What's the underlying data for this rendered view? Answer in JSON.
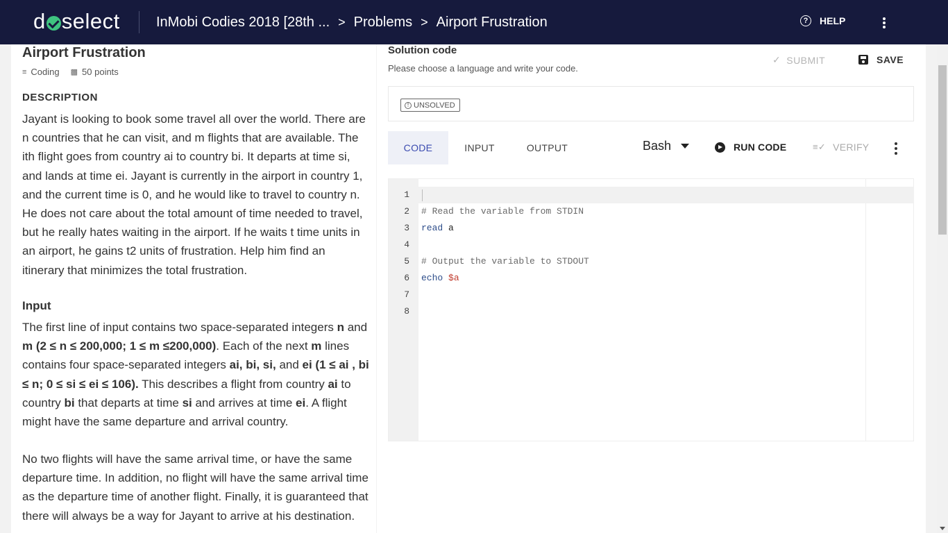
{
  "header": {
    "logo_pre": "d",
    "logo_post": "select",
    "breadcrumbs": [
      "InMobi Codies 2018 [28th ...",
      "Problems",
      "Airport Frustration"
    ],
    "separator": ">",
    "help_label": "HELP",
    "help_icon": "?"
  },
  "problem": {
    "title": "Airport Frustration",
    "type_label": "Coding",
    "points_label": "50 points",
    "description_heading": "DESCRIPTION",
    "description": "Jayant is looking to book some travel all over the world. There are n countries that he can visit, and m flights that are available. The ith flight goes from country ai to country bi. It departs at time si, and lands at time ei. Jayant is currently in the airport in country 1, and the current time is 0, and he would like to travel to country n. He does not care about the total amount of time needed to travel, but he really hates waiting in the airport. If he waits t time units in an airport, he gains t2 units of frustration. Help him find an itinerary that minimizes the total frustration.",
    "input_heading": "Input",
    "input_parts": [
      "The first line of input contains two space-separated integers ",
      "n",
      " and ",
      "m (2 ≤ n ≤ 200,000; 1 ≤ m ≤200,000)",
      ". Each of the next ",
      "m",
      " lines contains four space-separated integers ",
      "ai, bi, si,",
      " and ",
      "ei (1 ≤ ai , bi ≤ n; 0 ≤ si ≤ ei ≤ 106).",
      " This describes a flight from country ",
      "ai",
      " to country ",
      "bi",
      " that departs at time ",
      "si",
      " and arrives at time ",
      "ei",
      ". A flight might have the same departure and arrival country."
    ],
    "paragraph3": "No two flights will have the same arrival time, or have the same departure time. In addition, no flight will have the same arrival time as the departure time of another flight. Finally, it is guaranteed that there will always be a way for Jayant to arrive at his destination."
  },
  "solution": {
    "title": "Solution code",
    "subtitle": "Please choose a language and write your code.",
    "submit_label": "SUBMIT",
    "save_label": "SAVE",
    "status_badge": "UNSOLVED",
    "tabs": [
      "CODE",
      "INPUT",
      "OUTPUT"
    ],
    "active_tab": "CODE",
    "language": "Bash",
    "run_label": "RUN CODE",
    "verify_label": "VERIFY"
  },
  "editor": {
    "line_numbers": [
      "1",
      "2",
      "3",
      "4",
      "5",
      "6",
      "7",
      "8"
    ],
    "line2": "# Read the variable from STDIN",
    "line3_kw": "read",
    "line3_rest": " a",
    "line5": "# Output the variable to STDOUT",
    "line6_kw": "echo",
    "line6_var": "$a"
  },
  "colors": {
    "header_bg": "#161a3d",
    "logo_accent": "#3fc380",
    "active_tab_text": "#3b4bb0"
  }
}
